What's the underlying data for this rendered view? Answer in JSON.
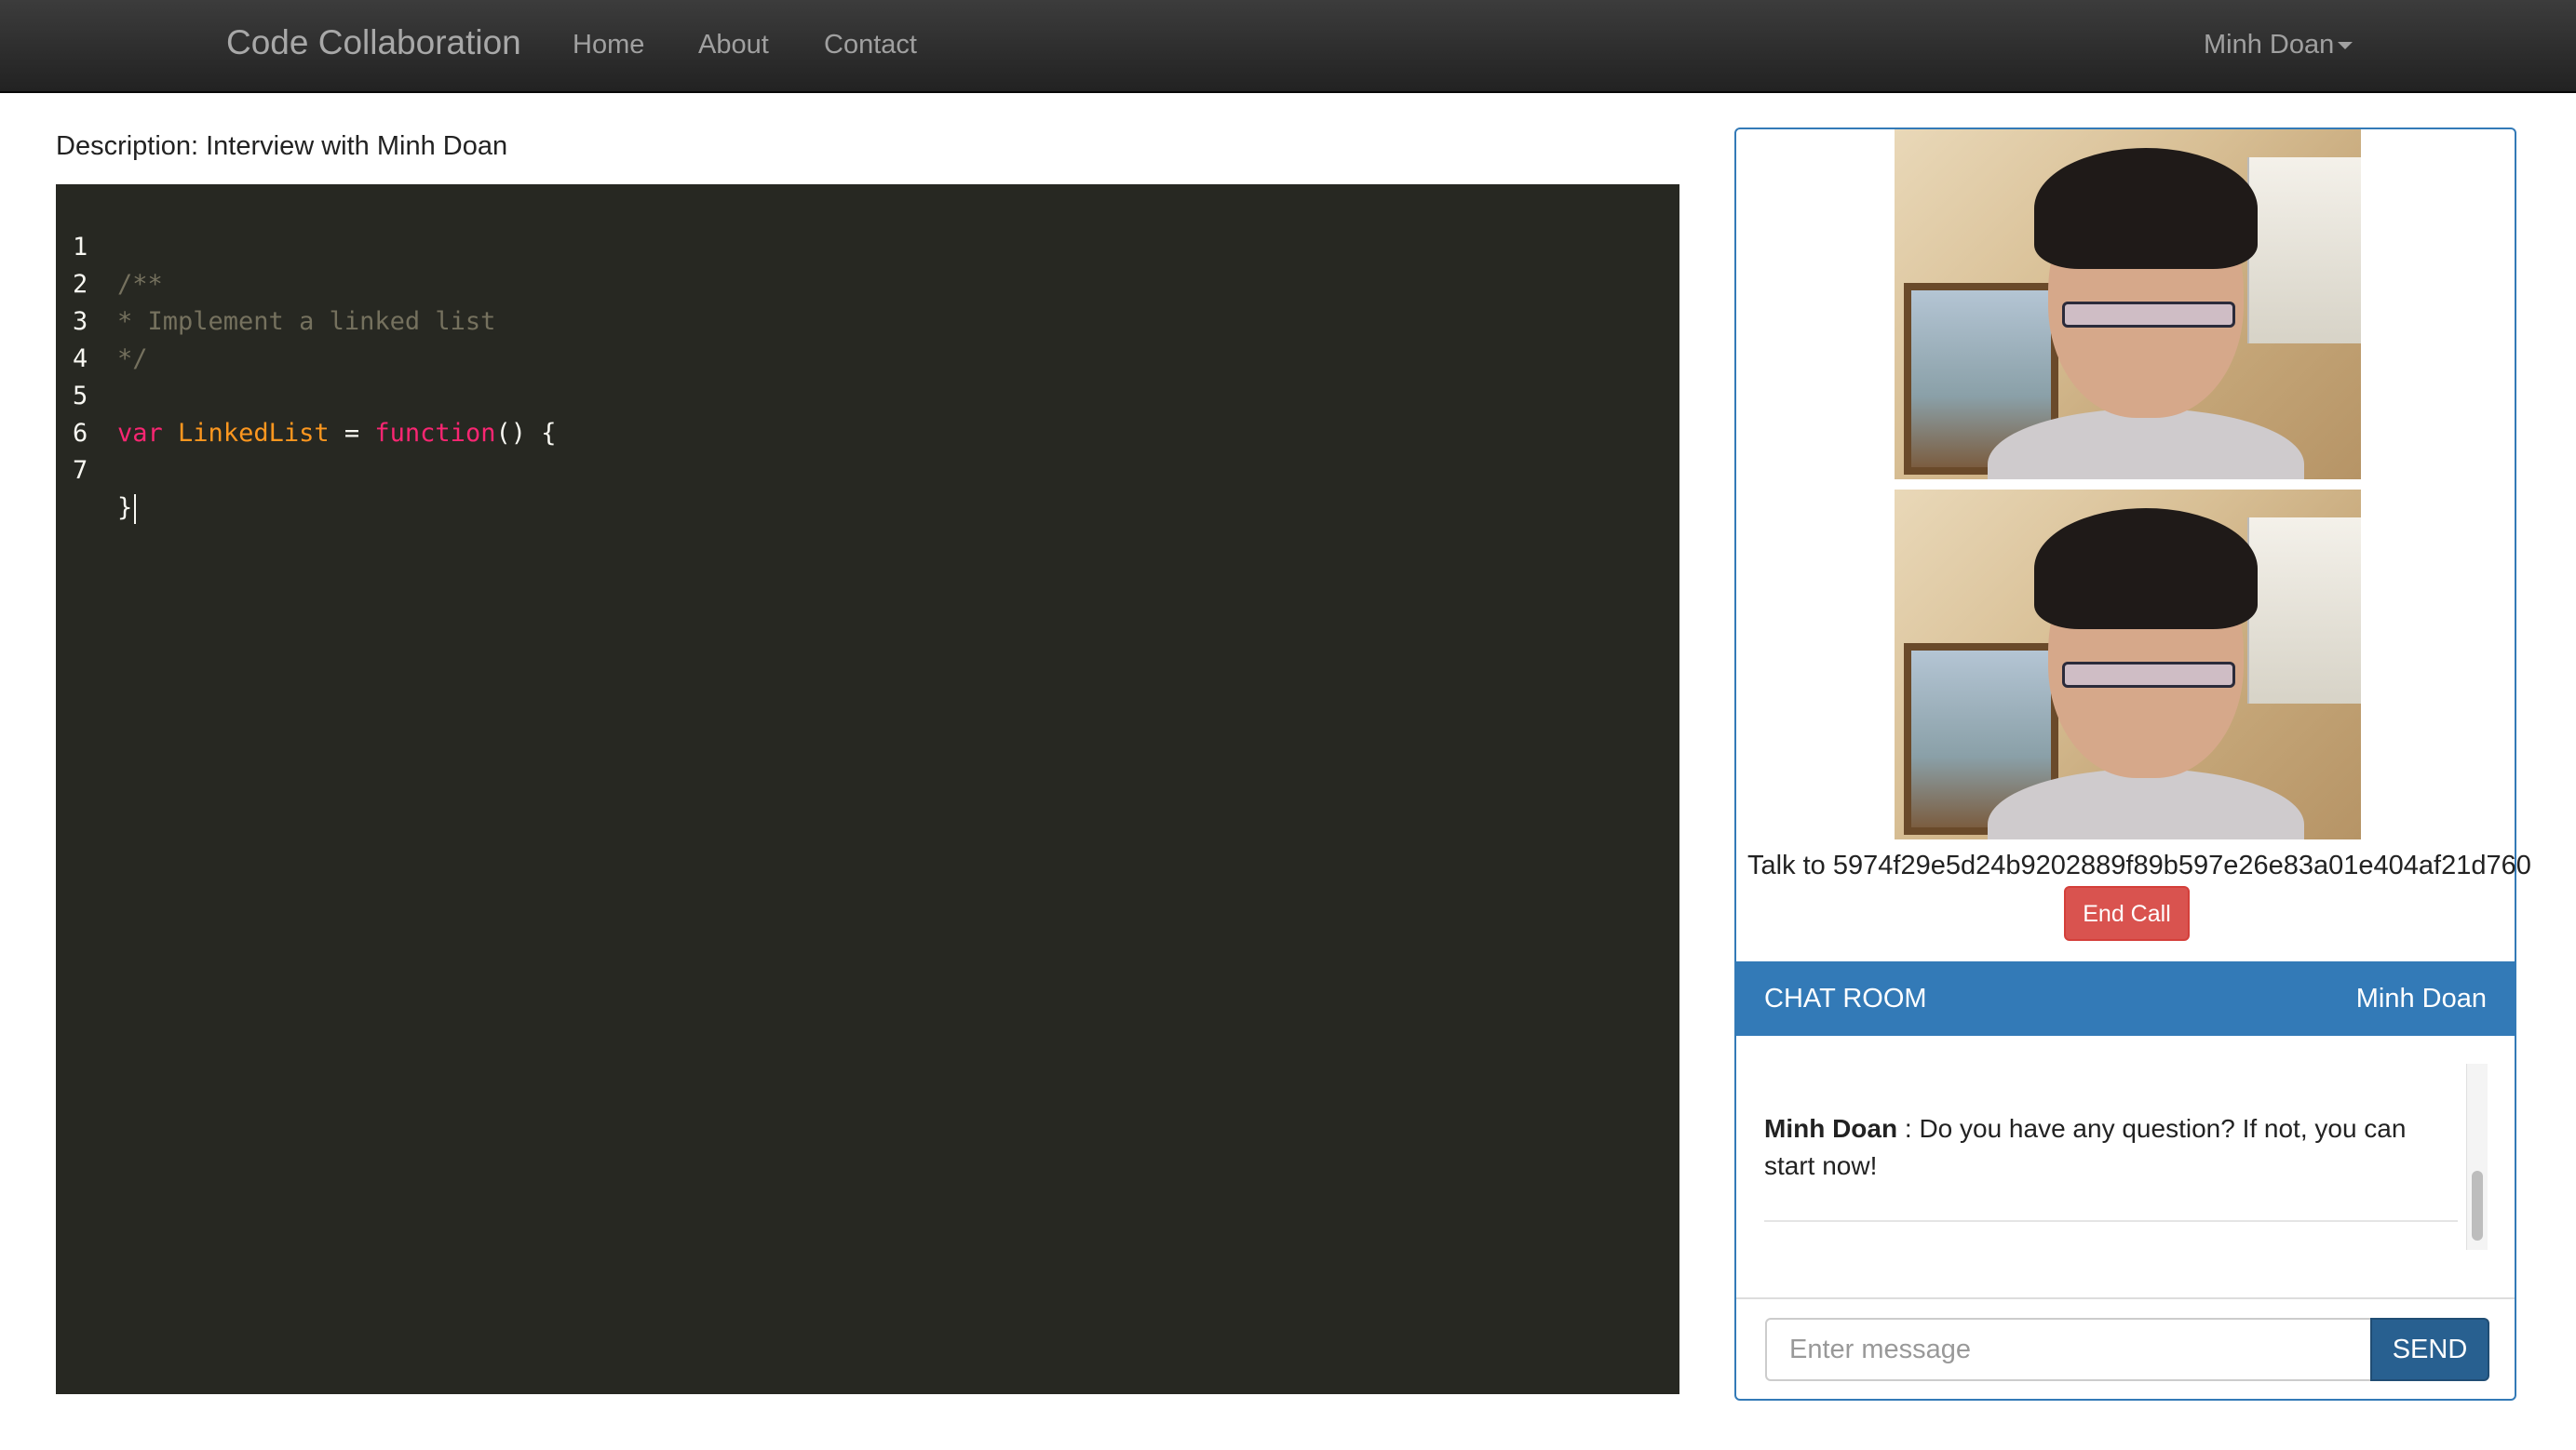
{
  "navbar": {
    "brand": "Code Collaboration",
    "links": [
      "Home",
      "About",
      "Contact"
    ],
    "user": "Minh Doan"
  },
  "description": {
    "label": "Description:",
    "text": "Interview with Minh Doan"
  },
  "editor": {
    "language": "javascript",
    "theme": "monokai",
    "lines": [
      {
        "num": "1",
        "text": "/**"
      },
      {
        "num": "2",
        "text": "* Implement a linked list"
      },
      {
        "num": "3",
        "text": "*/"
      },
      {
        "num": "4",
        "text": ""
      },
      {
        "num": "5",
        "tokens": [
          "var",
          "LinkedList",
          "=",
          "function",
          "() {"
        ]
      },
      {
        "num": "6",
        "text": ""
      },
      {
        "num": "7",
        "text": "}"
      }
    ]
  },
  "video_call": {
    "talk_label": "Talk to",
    "peer_id": "5974f29e5d24b9202889f89b597e26e83a01e404af21d760",
    "end_call_label": "End Call"
  },
  "chat": {
    "title": "CHAT ROOM",
    "user": "Minh Doan",
    "messages": [
      {
        "author": "Minh Doan",
        "separator": " : ",
        "text": "Do you have any question? If not, you can start now!"
      }
    ],
    "input_placeholder": "Enter message",
    "send_label": "SEND"
  },
  "colors": {
    "navbar_bg": "#222222",
    "editor_bg": "#272822",
    "accent": "#337ab7",
    "danger": "#d9534f",
    "send_button": "#286090"
  }
}
